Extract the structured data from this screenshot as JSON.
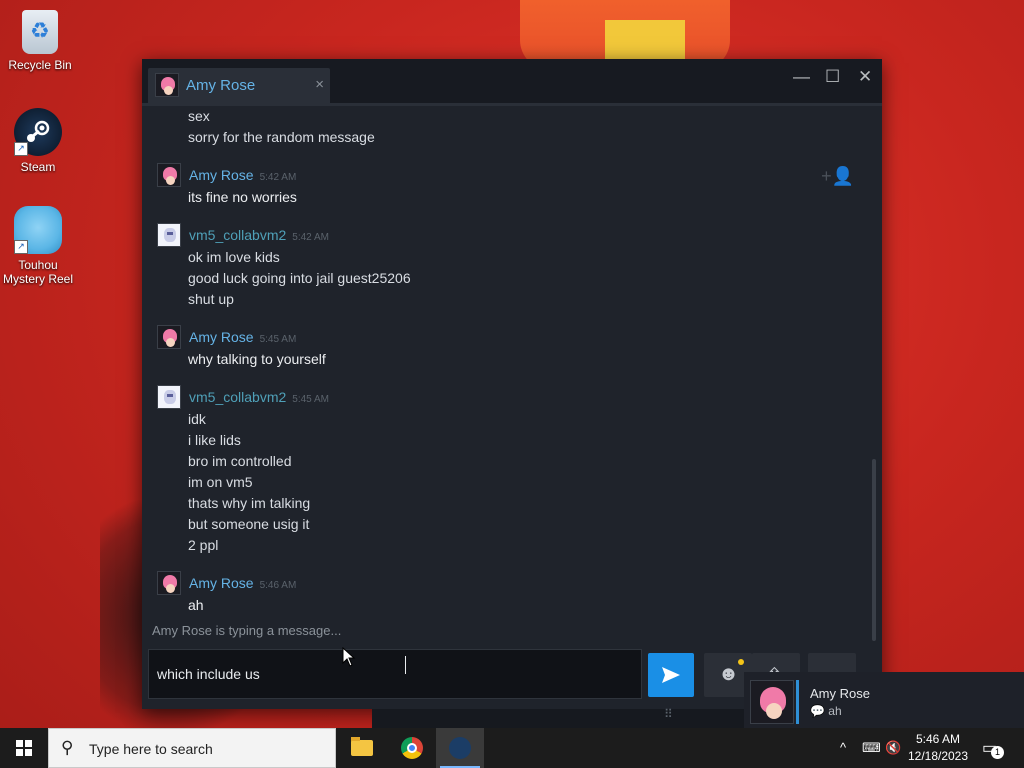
{
  "desktop": {
    "icons": [
      {
        "label": "Recycle Bin"
      },
      {
        "label": "Steam"
      },
      {
        "label": "Touhou Mystery Reel"
      }
    ]
  },
  "chat_window": {
    "tab_name": "Amy Rose",
    "tab_close": "×",
    "window_controls": {
      "minimize": "—",
      "maximize": "☐",
      "close": "✕"
    },
    "continuation_lines": [
      "sex",
      "sorry for the random message"
    ],
    "groups": [
      {
        "sender": "Amy Rose",
        "time": "5:42 AM",
        "lines": [
          "its fine no worries"
        ]
      },
      {
        "sender": "vm5_collabvm2",
        "time": "5:42 AM",
        "lines": [
          "ok im love kids",
          "good luck going into jail guest25206",
          "shut up"
        ]
      },
      {
        "sender": "Amy Rose",
        "time": "5:45 AM",
        "lines": [
          "why talking to yourself"
        ]
      },
      {
        "sender": "vm5_collabvm2",
        "time": "5:45 AM",
        "lines": [
          "idk",
          "i like lids",
          "bro im controlled",
          "im on vm5",
          "thats why im talking",
          "but someone usig it",
          "2 ppl"
        ]
      },
      {
        "sender": "Amy Rose",
        "time": "5:46 AM",
        "lines": [
          "ah"
        ]
      }
    ],
    "typing_indicator": "Amy Rose is typing a message...",
    "composer_value": "which include us"
  },
  "notification": {
    "name": "Amy Rose",
    "message": "ah"
  },
  "taskbar": {
    "search_placeholder": "Type here to search",
    "time": "5:46 AM",
    "date": "12/18/2023",
    "notification_count": "1"
  },
  "colors": {
    "accent": "#1a8fe6",
    "amy_name": "#65b3e6",
    "vm5_name": "#4fa0b8"
  }
}
